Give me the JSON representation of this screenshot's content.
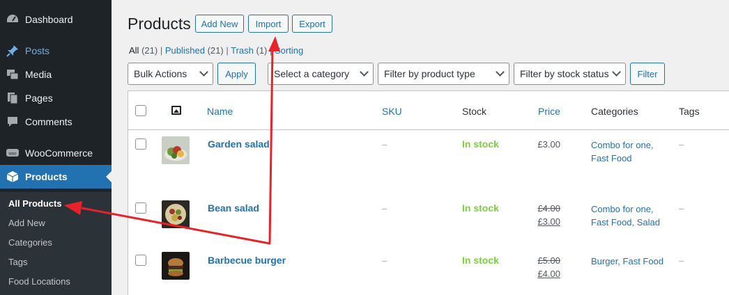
{
  "sidebar": {
    "items": [
      {
        "label": "Dashboard",
        "icon": "dashboard-icon"
      },
      {
        "label": "Posts",
        "icon": "pin-icon"
      },
      {
        "label": "Media",
        "icon": "media-icon"
      },
      {
        "label": "Pages",
        "icon": "pages-icon"
      },
      {
        "label": "Comments",
        "icon": "comment-icon"
      },
      {
        "label": "WooCommerce",
        "icon": "woocommerce-icon"
      },
      {
        "label": "Products",
        "icon": "box-icon"
      }
    ],
    "submenu": [
      "All Products",
      "Add New",
      "Categories",
      "Tags",
      "Food Locations"
    ]
  },
  "header": {
    "title": "Products",
    "buttons": {
      "add_new": "Add New",
      "import": "Import",
      "export": "Export"
    }
  },
  "views": {
    "all": "All",
    "all_count": "(21)",
    "published": "Published",
    "published_count": "(21)",
    "trash": "Trash",
    "trash_count": "(1)",
    "sorting": "Sorting",
    "sep": "|"
  },
  "filters": {
    "bulk_actions": "Bulk Actions",
    "apply": "Apply",
    "category": "Select a category",
    "product_type": "Filter by product type",
    "stock_status": "Filter by stock status",
    "filter": "Filter"
  },
  "table": {
    "columns": {
      "name": "Name",
      "sku": "SKU",
      "stock": "Stock",
      "price": "Price",
      "categories": "Categories",
      "tags": "Tags"
    },
    "rows": [
      {
        "name": "Garden salad",
        "sku": "–",
        "stock": "In stock",
        "price": "£3.00",
        "categories_line1": "Combo for one,",
        "categories_line2": "Fast Food",
        "tags": "–"
      },
      {
        "name": "Bean salad",
        "sku": "–",
        "stock": "In stock",
        "price_old": "£4.00",
        "price_new": "£3.00",
        "categories_line1": "Combo for one,",
        "categories_line2": "Fast Food, Salad",
        "tags": "–"
      },
      {
        "name": "Barbecue burger",
        "sku": "–",
        "stock": "In stock",
        "price_old": "£5.00",
        "price_new": "£4.00",
        "categories_line1": "Burger, Fast Food",
        "tags": "–"
      }
    ]
  },
  "colors": {
    "accent": "#2271b1",
    "in_stock": "#7ad03a",
    "annotation_arrow": "#e8222a",
    "sidebar_bg": "#1d2327"
  }
}
